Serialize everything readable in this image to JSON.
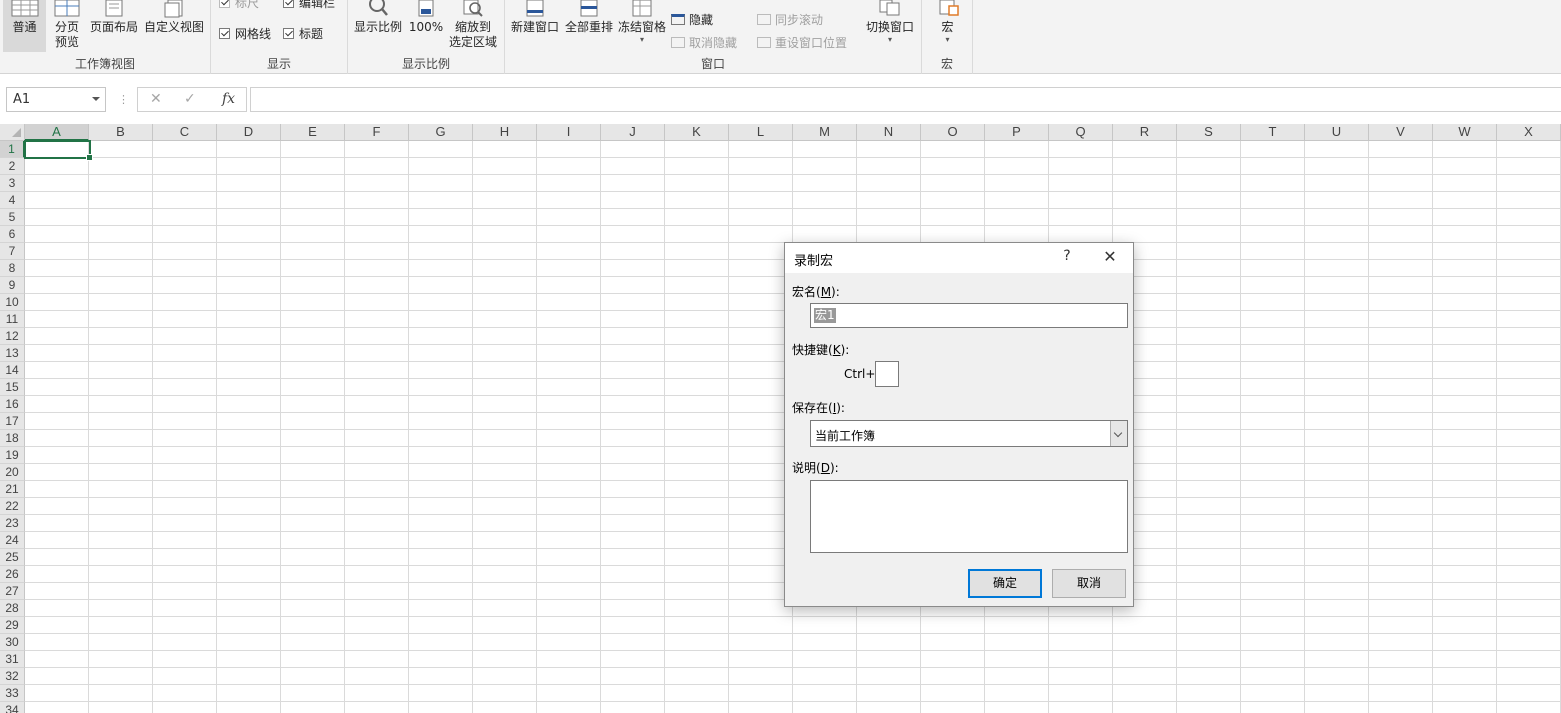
{
  "ribbon": {
    "workbook_view": {
      "group_label": "工作簿视图",
      "normal": "普通",
      "page_break_line1": "分页",
      "page_break_line2": "预览",
      "page_layout": "页面布局",
      "custom_view": "自定义视图"
    },
    "show": {
      "group_label": "显示",
      "ruler": "标尺",
      "formula_bar": "编辑栏",
      "gridlines": "网格线",
      "headings": "标题"
    },
    "zoom": {
      "group_label": "显示比例",
      "zoom": "显示比例",
      "zoom100": "100%",
      "zoom_sel_line1": "缩放到",
      "zoom_sel_line2": "选定区域"
    },
    "window": {
      "group_label": "窗口",
      "new_window": "新建窗口",
      "arrange_all": "全部重排",
      "freeze_panes": "冻结窗格",
      "hide": "隐藏",
      "unhide": "取消隐藏",
      "sync_scroll": "同步滚动",
      "reset_pos": "重设窗口位置",
      "switch_windows": "切换窗口"
    },
    "macros": {
      "group_label": "宏",
      "macros": "宏"
    }
  },
  "formula_bar": {
    "name_box": "A1",
    "fx": "fx",
    "formula": ""
  },
  "sheet": {
    "columns": [
      "A",
      "B",
      "C",
      "D",
      "E",
      "F",
      "G",
      "H",
      "I",
      "J",
      "K",
      "L",
      "M",
      "N",
      "O",
      "P",
      "Q",
      "R",
      "S",
      "T",
      "U",
      "V",
      "W",
      "X"
    ],
    "rows": [
      "1",
      "2",
      "3",
      "4",
      "5",
      "6",
      "7",
      "8",
      "9",
      "10",
      "11",
      "12",
      "13",
      "14",
      "15",
      "16",
      "17",
      "18",
      "19",
      "20",
      "21",
      "22",
      "23",
      "24",
      "25",
      "26",
      "27",
      "28",
      "29",
      "30",
      "31",
      "32",
      "33",
      "34"
    ],
    "active_cell": "A1"
  },
  "dialog": {
    "title": "录制宏",
    "help": "?",
    "close": "✕",
    "macro_name_label": "宏名(",
    "macro_name_key": "M",
    "macro_name_suffix": "):",
    "macro_name_value": "宏1",
    "shortcut_label": "快捷键(",
    "shortcut_key": "K",
    "shortcut_suffix": "):",
    "ctrl_prefix": "Ctrl+",
    "shortcut_value": "",
    "store_label": "保存在(",
    "store_key": "I",
    "store_suffix": "):",
    "store_value": "当前工作簿",
    "desc_label": "说明(",
    "desc_key": "D",
    "desc_suffix": "):",
    "desc_value": "",
    "ok": "确定",
    "cancel": "取消"
  },
  "colors": {
    "accent_green": "#217346",
    "focus_blue": "#0078d7"
  }
}
